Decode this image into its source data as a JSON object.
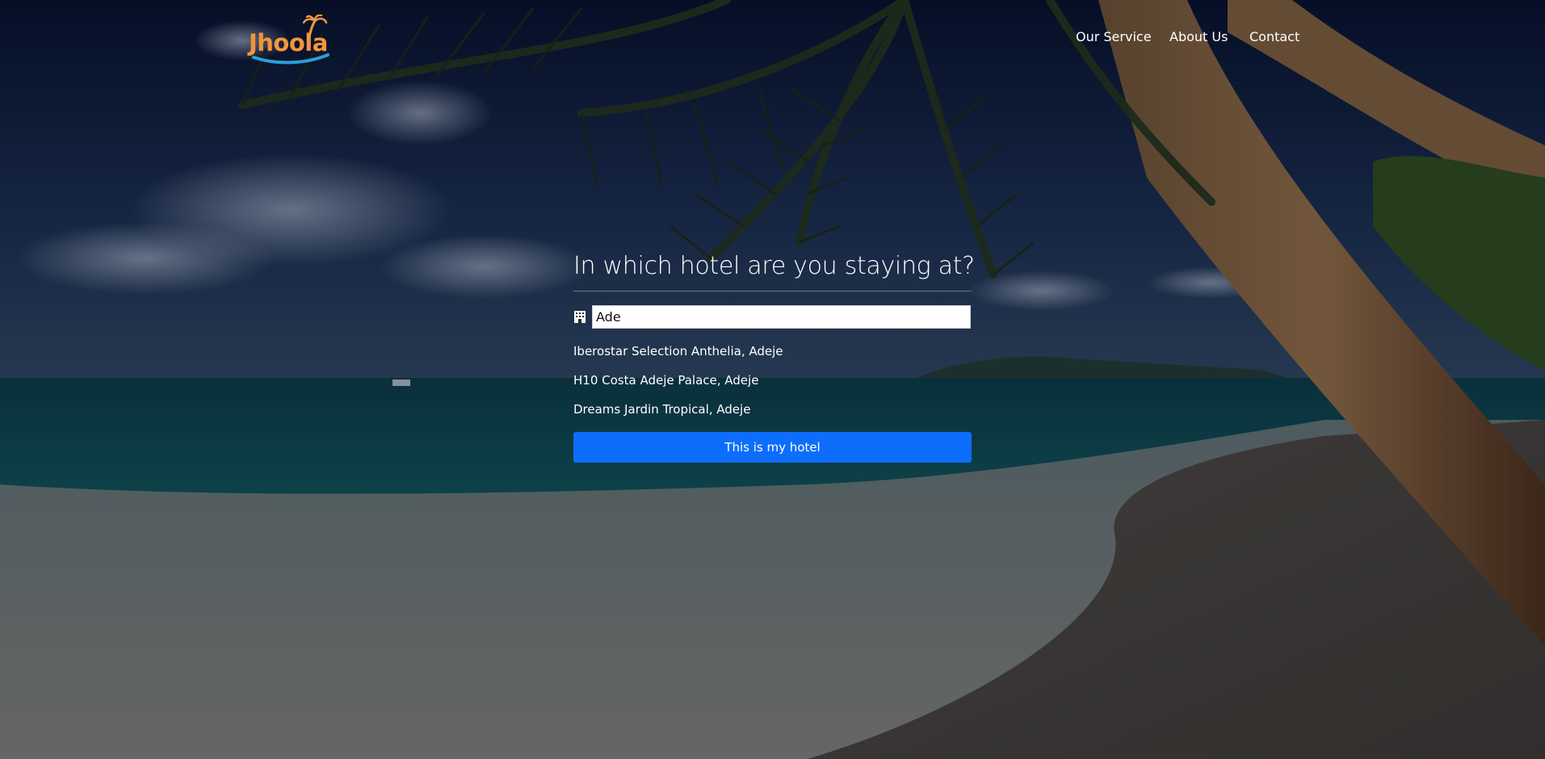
{
  "header": {
    "logo_text": "Jhoola",
    "nav": [
      {
        "label": "Our Service"
      },
      {
        "label": "About Us"
      },
      {
        "label": "Contact"
      }
    ]
  },
  "main": {
    "question": "In which hotel are you staying at?",
    "search": {
      "value": "Ade",
      "icon": "hotel-icon"
    },
    "suggestions": [
      "Iberostar Selection Anthelia, Adeje",
      "H10 Costa Adeje Palace, Adeje",
      "Dreams Jardin Tropical, Adeje"
    ],
    "confirm_label": "This is my hotel"
  },
  "colors": {
    "accent": "#0d6efd",
    "logo_orange": "#f3953a",
    "logo_wave": "#2a9fd6"
  }
}
